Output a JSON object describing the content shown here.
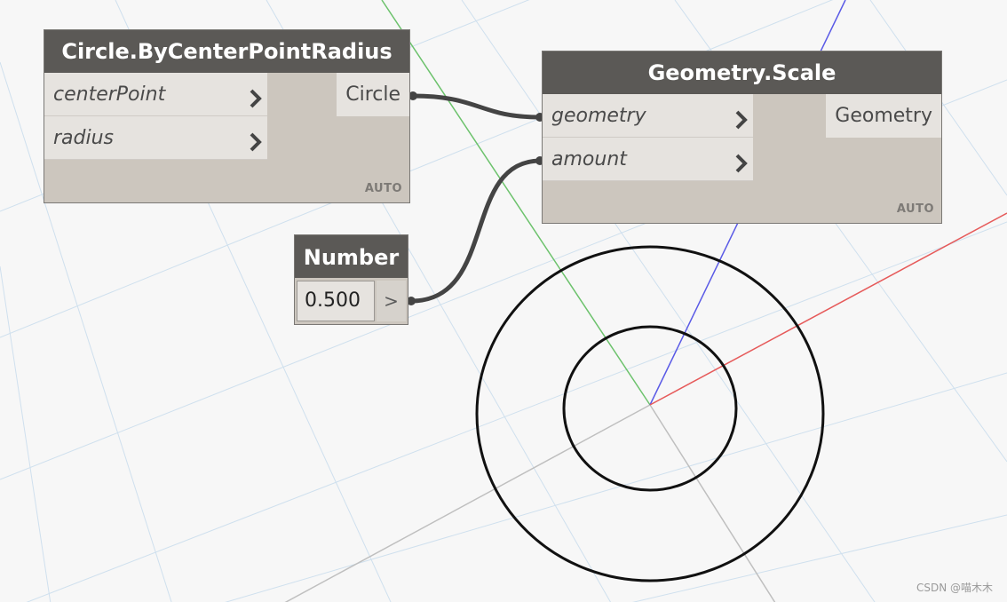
{
  "nodes": {
    "circle": {
      "title": "Circle.ByCenterPointRadius",
      "inputs": [
        "centerPoint",
        "radius"
      ],
      "output": "Circle",
      "lacing": "AUTO"
    },
    "scale": {
      "title": "Geometry.Scale",
      "inputs": [
        "geometry",
        "amount"
      ],
      "output": "Geometry",
      "lacing": "AUTO"
    },
    "number": {
      "title": "Number",
      "value": "0.500",
      "arrow": ">"
    }
  },
  "watermark": "CSDN @喵木木",
  "colors": {
    "background": "#f7f7f7",
    "grid": "#cfe0ee",
    "header": "#5b5956",
    "node_body": "#ccc6be",
    "port": "#e6e3df",
    "wire": "#444444",
    "axis_x": "#e65a5a",
    "axis_y": "#6cc26c",
    "axis_z": "#5a5ae6",
    "circle_stroke": "#111111"
  },
  "icons": {
    "port_chevron": "chevron-right-icon"
  }
}
